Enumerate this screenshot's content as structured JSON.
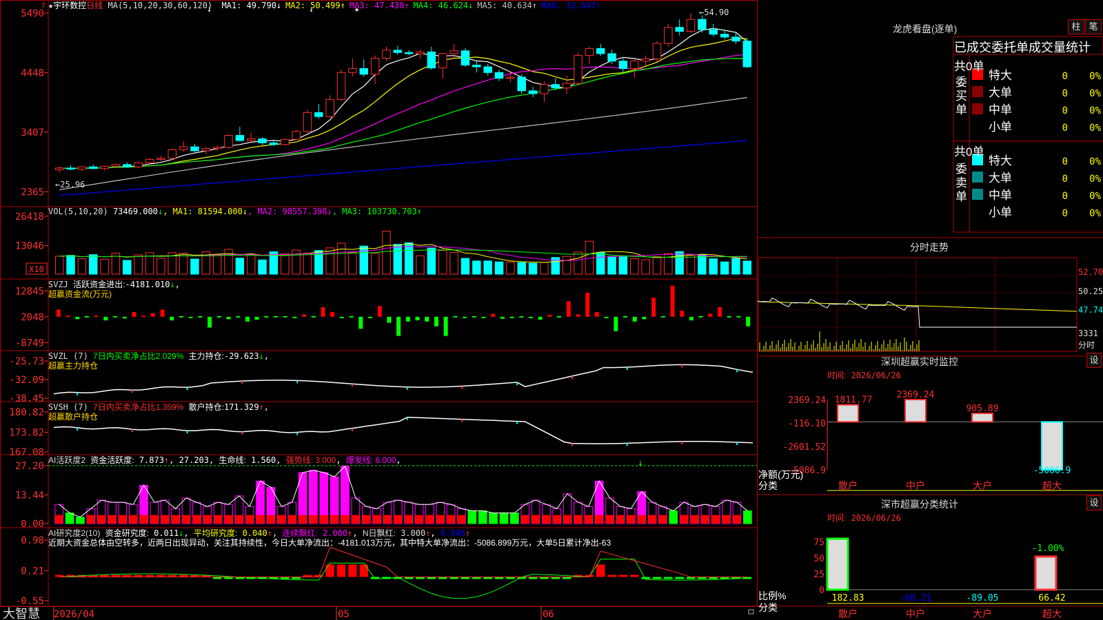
{
  "stock": {
    "name": "宇环数控",
    "period": "日线",
    "ma_header": "MA(5,10,20,30,60,120)",
    "ma_values": [
      {
        "label": "MA1:",
        "value": "49.790",
        "arrow": "↓",
        "color": "#ffffff"
      },
      {
        "label": "MA2:",
        "value": "50.499",
        "arrow": "↑",
        "color": "#ffff00"
      },
      {
        "label": "MA3:",
        "value": "47.430",
        "arrow": "↑",
        "color": "#ff00ff"
      },
      {
        "label": "MA4:",
        "value": "46.624",
        "arrow": "↓",
        "color": "#00ff00"
      },
      {
        "label": "MA5:",
        "value": "40.634",
        "arrow": "↑",
        "color": "#c0c0c0"
      },
      {
        "label": "MA6:",
        "value": "32.647",
        "arrow": "↑",
        "color": "#0000ff"
      }
    ],
    "price_axis": [
      "5490",
      "4448",
      "3407",
      "2365"
    ],
    "price_axis_marker": "?",
    "price_range": {
      "min": 2200,
      "max": 5550
    },
    "high_label": "54.90",
    "low_label": "25.96",
    "brand": "大智慧",
    "date_labels": [
      "2026/04",
      "05",
      "06"
    ],
    "candles": [
      [
        27.5,
        28.0,
        27.0,
        27.8
      ],
      [
        27.8,
        28.3,
        27.4,
        27.6
      ],
      [
        27.6,
        28.1,
        27.3,
        28.0
      ],
      [
        28.0,
        28.4,
        27.6,
        27.7
      ],
      [
        27.7,
        28.2,
        27.4,
        28.1
      ],
      [
        28.1,
        28.6,
        27.8,
        28.4
      ],
      [
        28.4,
        28.8,
        27.9,
        28.0
      ],
      [
        28.0,
        28.9,
        27.8,
        28.7
      ],
      [
        28.7,
        29.5,
        28.4,
        29.3
      ],
      [
        29.3,
        30.0,
        29.0,
        29.5
      ],
      [
        29.5,
        31.2,
        29.2,
        31.0
      ],
      [
        31.0,
        32.5,
        30.6,
        31.5
      ],
      [
        31.5,
        32.0,
        30.6,
        30.8
      ],
      [
        30.8,
        31.5,
        30.3,
        31.2
      ],
      [
        31.2,
        31.8,
        30.8,
        31.4
      ],
      [
        31.4,
        33.8,
        31.2,
        33.5
      ],
      [
        33.5,
        35.0,
        32.4,
        32.6
      ],
      [
        32.6,
        34.0,
        32.2,
        32.9
      ],
      [
        32.9,
        33.2,
        31.8,
        32.2
      ],
      [
        32.2,
        32.5,
        31.6,
        31.9
      ],
      [
        31.9,
        33.0,
        31.7,
        32.8
      ],
      [
        32.8,
        34.5,
        32.6,
        34.2
      ],
      [
        34.2,
        38.0,
        34.0,
        37.5
      ],
      [
        37.5,
        39.0,
        36.4,
        36.8
      ],
      [
        36.8,
        40.5,
        36.6,
        39.8
      ],
      [
        39.8,
        45.0,
        39.5,
        44.5
      ],
      [
        44.5,
        47.0,
        43.8,
        45.2
      ],
      [
        45.2,
        46.8,
        43.8,
        44.2
      ],
      [
        44.2,
        47.5,
        42.5,
        47.0
      ],
      [
        47.0,
        49.0,
        46.5,
        48.4
      ],
      [
        48.4,
        49.2,
        47.6,
        48.0
      ],
      [
        48.0,
        48.4,
        47.5,
        47.8
      ],
      [
        47.8,
        48.5,
        47.0,
        48.1
      ],
      [
        48.1,
        49.0,
        45.0,
        45.3
      ],
      [
        45.3,
        48.0,
        43.5,
        47.8
      ],
      [
        47.8,
        49.5,
        47.0,
        48.3
      ],
      [
        48.3,
        48.8,
        45.5,
        45.8
      ],
      [
        45.8,
        46.5,
        44.5,
        45.5
      ],
      [
        45.5,
        46.0,
        44.0,
        44.5
      ],
      [
        44.5,
        45.0,
        43.0,
        43.5
      ],
      [
        43.5,
        44.6,
        42.8,
        43.7
      ],
      [
        43.7,
        44.2,
        40.8,
        41.3
      ],
      [
        41.3,
        42.0,
        40.2,
        40.8
      ],
      [
        40.8,
        43.0,
        39.3,
        42.4
      ],
      [
        42.4,
        43.5,
        41.4,
        41.8
      ],
      [
        41.8,
        44.0,
        40.8,
        42.6
      ],
      [
        42.6,
        48.0,
        42.2,
        47.5
      ],
      [
        47.5,
        49.0,
        46.0,
        48.7
      ],
      [
        48.7,
        49.5,
        47.4,
        47.8
      ],
      [
        47.8,
        48.5,
        46.0,
        46.5
      ],
      [
        46.5,
        47.0,
        44.5,
        45.2
      ],
      [
        45.2,
        46.8,
        43.6,
        46.5
      ],
      [
        46.5,
        47.5,
        45.6,
        46.9
      ],
      [
        46.9,
        50.0,
        46.4,
        49.6
      ],
      [
        49.6,
        53.0,
        49.0,
        52.4
      ],
      [
        52.4,
        53.8,
        51.0,
        51.7
      ],
      [
        51.7,
        54.9,
        51.4,
        53.8
      ],
      [
        53.8,
        54.5,
        51.5,
        52.0
      ],
      [
        52.0,
        53.0,
        50.8,
        51.2
      ],
      [
        51.2,
        52.0,
        50.3,
        50.7
      ],
      [
        50.7,
        51.5,
        49.5,
        50.0
      ],
      [
        50.0,
        50.5,
        45.3,
        45.5
      ]
    ],
    "vol": {
      "header": "VOL(5,10,20)",
      "value": "73469.000",
      "value_arrow": "↓",
      "ma_values": [
        {
          "label": "MA1:",
          "value": "81594.000",
          "arrow": "↓",
          "color": "#ffff00"
        },
        {
          "label": "MA2:",
          "value": "98557.398",
          "arrow": "↓",
          "color": "#ff00ff"
        },
        {
          "label": "MA3:",
          "value": "103730.703",
          "arrow": "↑",
          "color": "#00ff00"
        }
      ],
      "axis": [
        "26418",
        "13046"
      ],
      "unit": "X10",
      "max": 27000,
      "bars": [
        8200,
        8600,
        7100,
        8900,
        6800,
        9600,
        6300,
        8800,
        9800,
        7300,
        9800,
        9600,
        6900,
        10200,
        9000,
        11300,
        7300,
        8900,
        6500,
        10200,
        9400,
        11000,
        9600,
        10800,
        12000,
        14100,
        9900,
        12800,
        9500,
        19600,
        13600,
        14300,
        8400,
        11900,
        10800,
        9900,
        7200,
        6000,
        6000,
        5600,
        5500,
        5300,
        5000,
        5400,
        7600,
        8100,
        10100,
        15000,
        9900,
        8100,
        7900,
        7100,
        6600,
        8000,
        9400,
        10300,
        8900,
        8800,
        7000,
        5600,
        7200,
        6000
      ]
    },
    "svzj": {
      "header_name": "SVZJ",
      "header_label": "活跃资金进出:",
      "header_value": "-4181.010",
      "header_arrow": "↓",
      "subtitle": "超赢资金流(万元)",
      "axis": [
        "12845",
        "2048",
        "-8749"
      ],
      "min": -9500,
      "max": 13500,
      "bars": [
        3000,
        500,
        -1000,
        0,
        500,
        -1500,
        0,
        -700,
        2000,
        500,
        1500,
        3000,
        -1500,
        0,
        -500,
        0,
        -4500,
        0,
        -1000,
        0,
        -2000,
        -1200,
        0,
        0,
        0,
        -300,
        1000,
        0,
        4000,
        2000,
        -300,
        0,
        -5000,
        -500,
        4500,
        -2500,
        -8000,
        -2000,
        -1500,
        -2000,
        -4000,
        -8000,
        0,
        -500,
        0,
        -300,
        1200,
        -800,
        -500,
        0,
        -500,
        -1200,
        800,
        0,
        6500,
        1000,
        10000,
        2000,
        -500,
        -6000,
        0,
        -2000,
        -1000,
        8000,
        0,
        13000,
        2500,
        -1500,
        0,
        1300,
        4000,
        0,
        0,
        -4000
      ]
    },
    "svzl": {
      "header_name": "SVZL (7)",
      "header_ratio": "7日内买卖净占比2.029%",
      "header_label": "主力持仓:",
      "header_value": "-29.623",
      "header_arrow": "↓",
      "subtitle": "超赢主力持仓",
      "axis": [
        "-25.73",
        "-32.09",
        "-38.45"
      ],
      "min": -38.45,
      "max": -25.73
    },
    "svsh": {
      "header_name": "SVSH (7)",
      "header_ratio": "7日内买卖净占比1.359%",
      "header_label": "散户持仓:",
      "header_value": "171.329",
      "header_arrow": "↑",
      "subtitle": "超赢散户持仓",
      "axis": [
        "180.82",
        "173.82",
        "167.08"
      ],
      "min": 167.08,
      "max": 180.82
    },
    "ai_active": {
      "header_name": "AI活跃度2",
      "header_label": "资金活跃度:",
      "header_value1": "7.873",
      "header_arrow1": "↑",
      "header_value2": "27.203",
      "header_label2": "生命线:",
      "header_value3": "1.560",
      "strong_label": "强势线: 3.000",
      "burst_label": "爆发线: 6.000",
      "axis": [
        "27.20",
        "13.44",
        "0.00"
      ],
      "max": 27.2,
      "values": [
        9,
        5,
        3,
        7,
        11,
        10,
        10,
        9,
        18,
        10,
        11,
        7,
        12,
        10,
        8,
        10,
        9,
        13,
        8,
        20,
        17,
        8,
        10,
        24,
        25,
        24,
        22,
        27,
        12,
        8,
        7,
        10,
        11,
        10,
        9,
        9,
        10,
        9,
        7,
        6,
        6,
        5,
        5,
        5,
        9,
        11,
        9,
        7,
        14,
        10,
        8,
        20,
        12,
        8,
        7,
        15,
        10,
        8,
        6,
        10,
        8,
        9,
        8,
        11,
        10,
        6
      ]
    },
    "ai_research": {
      "header_name": "AI研究度2(10)",
      "header_label": "资金研究度:",
      "header_value1": "0.011",
      "header_arrow1": "↓",
      "avg_label": "平均研究度:",
      "avg_value": "0.040",
      "avg_arrow": "↑",
      "red_label": "连续飘红:",
      "red_value": "2.000",
      "red_arrow": "↑",
      "nday_label": "N日飘红:",
      "nday_value": "3.000",
      "nday_arrow": "↑",
      "extra_value": "0.046",
      "extra_arrow": "↑",
      "comment": "近期大资金总体由空转多，近两日出现异动，关注其持续性，今日大单净流出：-4181.013万元，其中特大单净流出：-5086.899万元，大单5日累计净出-63",
      "axis": [
        "0.98",
        "0.21",
        "-0.55"
      ]
    },
    "right": {
      "lhb_title": "龙虎看盘(逐单)",
      "btn_bar": "柱",
      "btn_pen": "笔",
      "orders_header": "已成交委托单成交量统计",
      "buy_label": "委买单",
      "sell_label": "委卖单",
      "buy_count": "共0单",
      "sell_count": "共0单",
      "order_rows": [
        "特大",
        "大单",
        "中单",
        "小单"
      ],
      "order_value": "0",
      "order_pct": "0%",
      "buy_colors": [
        "#ff0000",
        "#8b0000",
        "#8b0000",
        "#000000"
      ],
      "sell_colors": [
        "#00ffff",
        "#008b8b",
        "#008b8b",
        "#000000"
      ],
      "intraday_title": "分时走势",
      "intraday_axis": [
        "52.70",
        "50.25",
        "47.74"
      ],
      "intraday_vol": "3331",
      "intraday_label": "分时",
      "sz_monitor_title": "深圳超赢实时监控",
      "date_label": "时间:",
      "date_value": "2026/06/26",
      "net_axis": [
        "2369.24",
        "-116.10",
        "-2601.52",
        "-5086.9"
      ],
      "net_label": "净额(万元)",
      "category_label": "分类",
      "categories": [
        "散户",
        "中户",
        "大户",
        "超大"
      ],
      "net_values": [
        "1811.77",
        "2369.24",
        "905.89",
        "-5086.9"
      ],
      "setting_label": "设",
      "sz_class_title": "深市超赢分类统计",
      "ratio_label": "比例%",
      "ratio_axis": [
        "75",
        "50",
        "25",
        "0"
      ],
      "ratio_top": "-1.00%",
      "ratio_values": [
        "182.83",
        "-60.21",
        "-89.05",
        "66.42"
      ],
      "ratio_colors": [
        "#ffff00",
        "#0000ff",
        "#00ffff",
        "#ffff00"
      ]
    }
  }
}
